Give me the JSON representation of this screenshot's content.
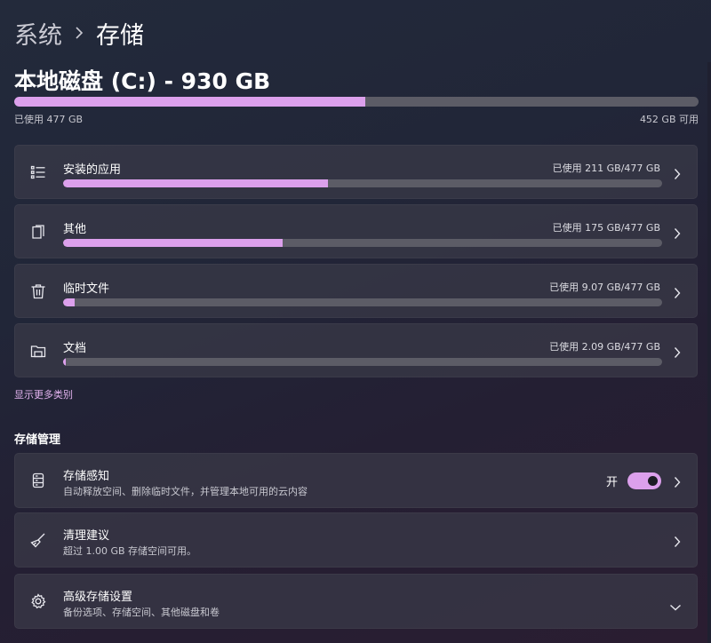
{
  "breadcrumb": {
    "parent": "系统",
    "current": "存储"
  },
  "disk": {
    "title": "本地磁盘 (C:) - 930 GB",
    "used_fraction": 0.513,
    "used_label": "已使用 477 GB",
    "free_label": "452 GB 可用"
  },
  "categories": [
    {
      "label": "安装的应用",
      "usage": "已使用 211 GB/477 GB",
      "fraction": 0.442,
      "icon": "apps-list-icon"
    },
    {
      "label": "其他",
      "usage": "已使用 175 GB/477 GB",
      "fraction": 0.367,
      "icon": "other-files-icon"
    },
    {
      "label": "临时文件",
      "usage": "已使用 9.07 GB/477 GB",
      "fraction": 0.019,
      "icon": "trash-icon"
    },
    {
      "label": "文档",
      "usage": "已使用 2.09 GB/477 GB",
      "fraction": 0.004,
      "icon": "folder-icon"
    }
  ],
  "show_more": "显示更多类别",
  "management": {
    "title": "存储管理",
    "items": [
      {
        "title": "存储感知",
        "desc": "自动释放空间、删除临时文件，并管理本地可用的云内容",
        "icon": "storage-drive-icon",
        "toggle_label": "开",
        "toggle_on": true
      },
      {
        "title": "清理建议",
        "desc": "超过 1.00 GB 存储空间可用。",
        "icon": "broom-icon"
      },
      {
        "title": "高级存储设置",
        "desc": "备份选项、存储空间、其他磁盘和卷",
        "icon": "gear-icon"
      }
    ]
  },
  "colors": {
    "accent": "#dca0ec",
    "track": "#5c5c66"
  }
}
